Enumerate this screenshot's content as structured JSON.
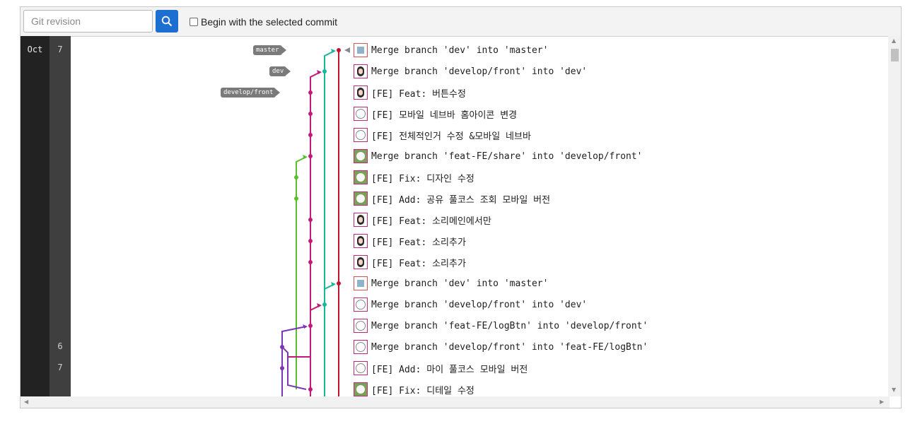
{
  "toolbar": {
    "revision_placeholder": "Git revision",
    "search_icon": "search-icon",
    "begin_label": "Begin with the selected commit",
    "begin_checked": false
  },
  "dates": {
    "months": [
      {
        "label": "Oct",
        "row": 0
      }
    ],
    "days": [
      {
        "label": "7",
        "row": 0
      },
      {
        "label": "6",
        "row": 14
      },
      {
        "label": "7",
        "row": 15
      }
    ]
  },
  "refs": [
    {
      "label": "master",
      "row": 0
    },
    {
      "label": "dev",
      "row": 1
    },
    {
      "label": "develop/front",
      "row": 2
    }
  ],
  "lane_colors": [
    "#c0142c",
    "#16b896",
    "#c01b7c",
    "#5abf2a",
    "#7a35b8"
  ],
  "commits": [
    {
      "message": "Merge branch 'dev' into 'master'",
      "avatar": "identicon-avatar"
    },
    {
      "message": "Merge branch 'develop/front' into 'dev'",
      "avatar": "photo-avatar"
    },
    {
      "message": "[FE] Feat: 버튼수정",
      "avatar": "photo-avatar"
    },
    {
      "message": "[FE] 모바일 네브바 홈아이콘 변경",
      "avatar": "cartoon-avatar"
    },
    {
      "message": "[FE] 전체적인거 수정 &모바일 네브바",
      "avatar": "cartoon-avatar"
    },
    {
      "message": "Merge branch 'feat-FE/share' into 'develop/front'",
      "avatar": "dog-avatar"
    },
    {
      "message": "[FE] Fix: 디자인 수정",
      "avatar": "dog-avatar"
    },
    {
      "message": "[FE] Add: 공유 풀코스 조회 모바일 버전",
      "avatar": "dog-avatar"
    },
    {
      "message": "[FE] Feat: 소리메인에서만",
      "avatar": "photo-avatar"
    },
    {
      "message": "[FE] Feat: 소리추가",
      "avatar": "photo-avatar"
    },
    {
      "message": "[FE] Feat: 소리추가",
      "avatar": "photo-avatar"
    },
    {
      "message": "Merge branch 'dev' into 'master'",
      "avatar": "identicon-avatar"
    },
    {
      "message": "Merge branch 'develop/front' into 'dev'",
      "avatar": "cartoon-avatar"
    },
    {
      "message": "Merge branch 'feat-FE/logBtn' into 'develop/front'",
      "avatar": "cartoon-avatar"
    },
    {
      "message": "Merge branch 'develop/front' into 'feat-FE/logBtn'",
      "avatar": "cartoon-avatar"
    },
    {
      "message": "[FE] Add: 마이 풀코스 모바일 버전",
      "avatar": "cartoon-avatar"
    },
    {
      "message": "[FE] Fix: 디테일 수정",
      "avatar": "dog-avatar"
    }
  ]
}
